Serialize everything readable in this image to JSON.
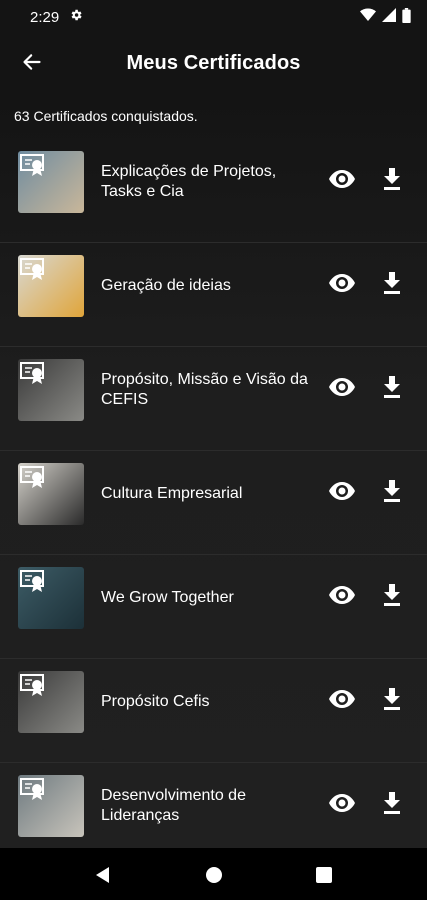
{
  "status_bar": {
    "time": "2:29",
    "icons": [
      "settings-gear-icon",
      "wifi-icon",
      "signal-icon",
      "battery-icon"
    ]
  },
  "header": {
    "title": "Meus Certificados",
    "back_icon": "arrow-left-icon"
  },
  "summary": {
    "count_text": "63 Certificados conquistados."
  },
  "certificates": [
    {
      "name": "Explicações de Projetos, Tasks e Cia",
      "thumb_colors": [
        "#6f8ca0",
        "#c9b79a"
      ]
    },
    {
      "name": "Geração de ideias",
      "thumb_colors": [
        "#d8d8d2",
        "#e0a53a"
      ]
    },
    {
      "name": "Propósito, Missão e Visão da CEFIS",
      "thumb_colors": [
        "#3a3a3a",
        "#8a8a86"
      ]
    },
    {
      "name": "Cultura Empresarial",
      "thumb_colors": [
        "#d5d2cb",
        "#2a2a2a"
      ]
    },
    {
      "name": "We Grow Together",
      "thumb_colors": [
        "#3d5c66",
        "#1c3038"
      ]
    },
    {
      "name": "Propósito Cefis",
      "thumb_colors": [
        "#3a3a3a",
        "#8a8a86"
      ]
    },
    {
      "name": "Desenvolvimento de Lideranças",
      "thumb_colors": [
        "#6e7a80",
        "#c8c4bb"
      ]
    }
  ],
  "row_action_icons": [
    "eye-icon",
    "download-icon"
  ],
  "nav_bar": {
    "icons": [
      "nav-back-icon",
      "nav-home-icon",
      "nav-recents-icon"
    ]
  },
  "colors": {
    "background": "#1c1c1c",
    "text": "#ffffff",
    "navbar": "#000000"
  }
}
